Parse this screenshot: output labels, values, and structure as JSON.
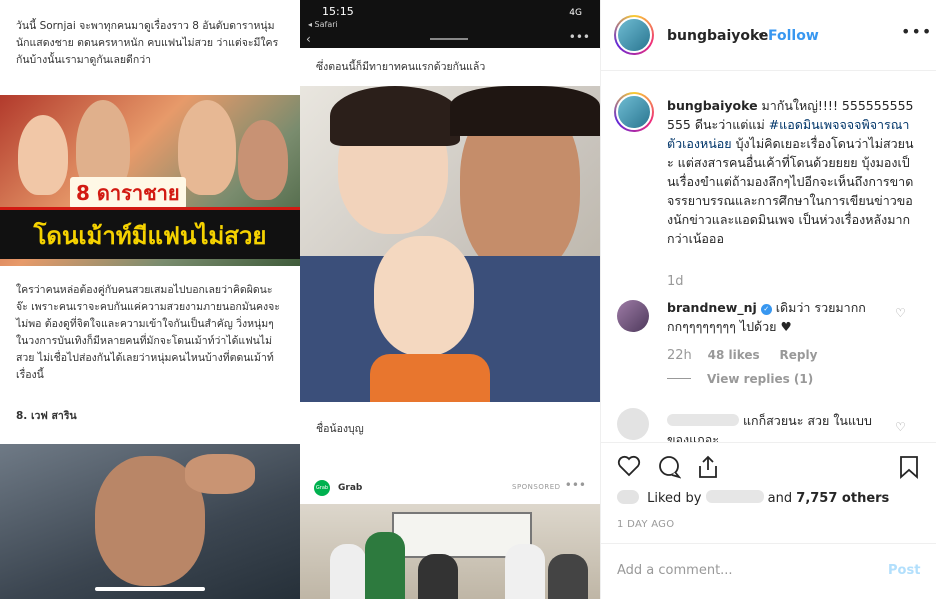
{
  "left_column": {
    "intro_text": "วันนี้ Sornjai จะพาทุกคนมาดูเรื่องราว 8 อันดับดาราหนุ่มนักแสดงชาย ตดนครหาหนัก คบแฟนไม่สวย ว่าแต่จะมีใครกันบ้างนั้นเรามาดูกันเลยดีกว่า",
    "banner_rank": "8 ดาราชาย",
    "banner_title": "โดนเม้าท์มีแฟนไม่สวย",
    "body_text": "ใครว่าคนหล่อต้องคู่กับคนสวยเสมอไปบอกเลยว่าคิดผิดนะจ๊ะ เพราะคนเราจะคบกันแค่ความสวยงามภายนอกมันคงจะไม่พอ ต้องดูที่จิตใจและความเข้าใจกันเป็นสำคัญ วิ่งหนุ่มๆในวงการบันเทิงก็มีหลายคนที่มักจะโดนเม้าท์ว่าได้แฟนไม่สวย ไม่เชื่อไปส่องกันได้เลยว่าหนุ่มคนไหนบ้างที่ตดนเม้าท์เรื่องนี้",
    "heading": "8. เวฟ สาริน"
  },
  "middle_column": {
    "status_time": "15:15",
    "status_app": "◂ Safari",
    "status_network": "4G",
    "caption_top": "ซึ่งตอนนี้ก็มีทายาทคนแรกด้วยกันแล้ว",
    "caption_bottom": "ชื่อน้องบุญ",
    "sponsor_name": "Grab",
    "sponsor_label": "SPONSORED"
  },
  "post": {
    "username": "bungbaiyoke",
    "follow": "Follow",
    "caption_user": "bungbaiyoke",
    "caption_part1": "มากันใหญ่!!!! 555555555555 ดีนะว่าแต่แม่ ",
    "caption_hashtag": "#แอดมินเพจจจจพิจารณาตัวเองหน่อย",
    "caption_part2": " บุ้งไม่คิดเยอะเรื่องโดนว่าไม่สวยนะ แต่สงสารคนอื่นเค้าที่โดนด้วยยยย บุ้งมองเป็นเรื่องขำแต่ถ้ามองลึกๆไปอีกจะเห็นถึงการขาดจรรยาบรรณและการศึกษาในการเขียนข่าวของนักข่าวและแอดมินเพจ เป็นห่วงเรื่องหลังมากกว่าเน้อออ",
    "caption_age": "1d",
    "comment1_user": "brandnew_nj",
    "comment1_text": "เดิมว่า รวยมากกกกๆๆๆๆๆๆๆๆ ไปด้วย ♥",
    "comment1_age": "22h",
    "comment1_likes": "48 likes",
    "comment1_reply": "Reply",
    "view_replies": "View replies (1)",
    "comment2_text": "แกก็สวยนะ สวย ในแบบของแกอะ",
    "liked_by_prefix": "Liked by",
    "liked_by_suffix": "and",
    "liked_by_count": "7,757 others",
    "date": "1 DAY AGO",
    "add_comment": "Add a comment...",
    "post_button": "Post"
  },
  "icons": {
    "heart": "heart-icon",
    "comment": "comment-icon",
    "share": "share-icon",
    "bookmark": "bookmark-icon",
    "more": "more-icon"
  },
  "colors": {
    "link": "#3897f0",
    "hashtag": "#003569",
    "grab": "#00b14f",
    "banner_red": "#d21a12",
    "banner_yellow": "#f5d200"
  }
}
